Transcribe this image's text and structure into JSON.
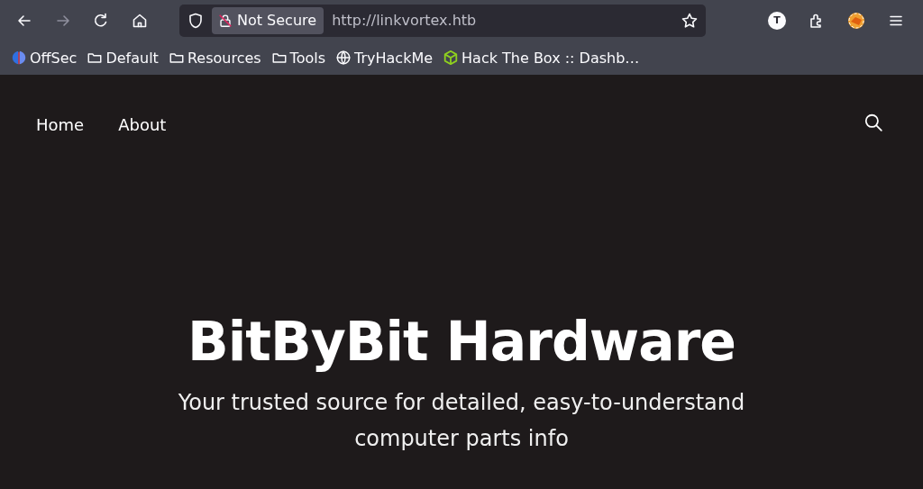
{
  "toolbar": {
    "nav_buttons": [
      {
        "kind": "back",
        "disabled": false
      },
      {
        "kind": "forward",
        "disabled": true
      },
      {
        "kind": "reload",
        "disabled": false
      },
      {
        "kind": "home",
        "disabled": false
      }
    ],
    "url_bar": {
      "security_label": "Not Secure",
      "url": "http://linkvortex.htb"
    },
    "account_badge": "T"
  },
  "bookmarks": [
    {
      "kind": "offsec",
      "label": "OffSec"
    },
    {
      "kind": "folder",
      "label": "Default"
    },
    {
      "kind": "folder",
      "label": "Resources"
    },
    {
      "kind": "folder",
      "label": "Tools"
    },
    {
      "kind": "globe",
      "label": "TryHackMe"
    },
    {
      "kind": "cube",
      "label": "Hack The Box :: Dashb…"
    }
  ],
  "page": {
    "nav": [
      "Home",
      "About"
    ],
    "title": "BitByBit Hardware",
    "subtitle": "Your trusted source for detailed, easy-to-understand computer parts info"
  }
}
